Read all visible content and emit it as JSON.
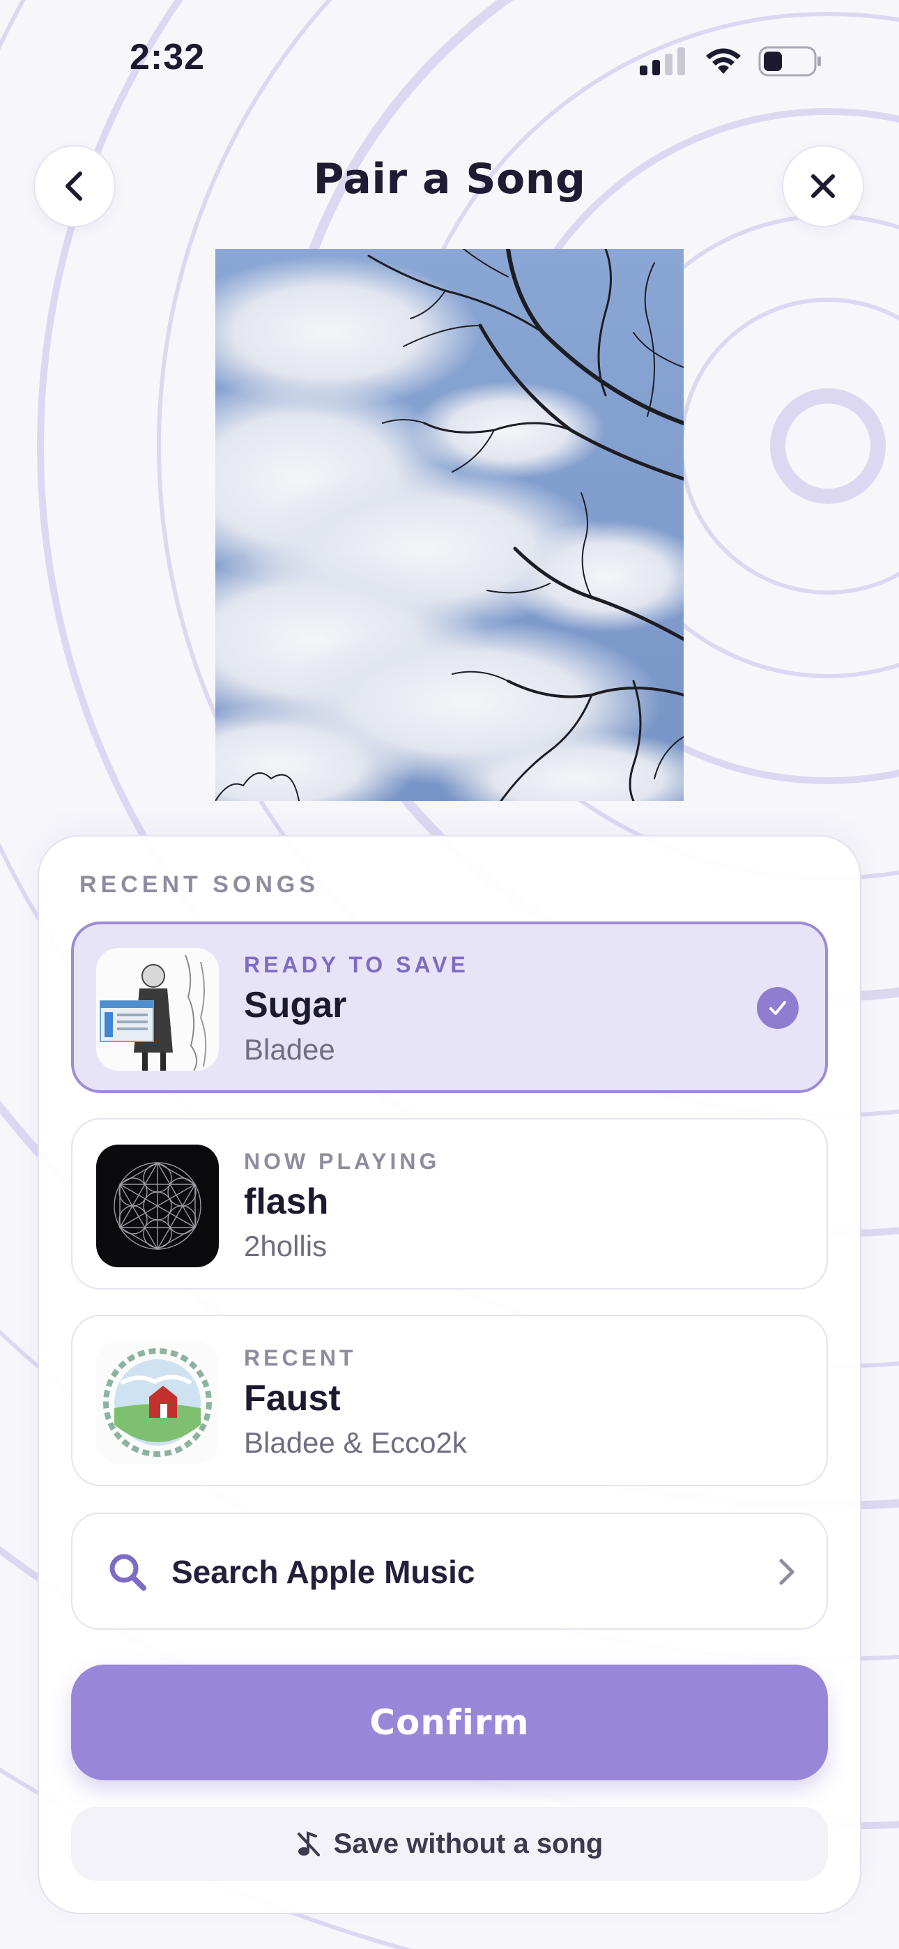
{
  "status_bar": {
    "time": "2:32"
  },
  "header": {
    "title": "Pair a Song"
  },
  "recent_section": {
    "title": "RECENT SONGS"
  },
  "songs": [
    {
      "status": "READY TO SAVE",
      "title": "Sugar",
      "artist": "Bladee",
      "selected": true
    },
    {
      "status": "NOW PLAYING",
      "title": "flash",
      "artist": "2hollis",
      "selected": false
    },
    {
      "status": "RECENT",
      "title": "Faust",
      "artist": "Bladee & Ecco2k",
      "selected": false
    }
  ],
  "search": {
    "label": "Search Apple Music"
  },
  "actions": {
    "confirm_label": "Confirm",
    "save_without_label": "Save without a song"
  },
  "colors": {
    "accent": "#9887d8",
    "accent_light": "#e8e4f8",
    "text": "#1b1a2e",
    "muted": "#8e8c9e"
  }
}
